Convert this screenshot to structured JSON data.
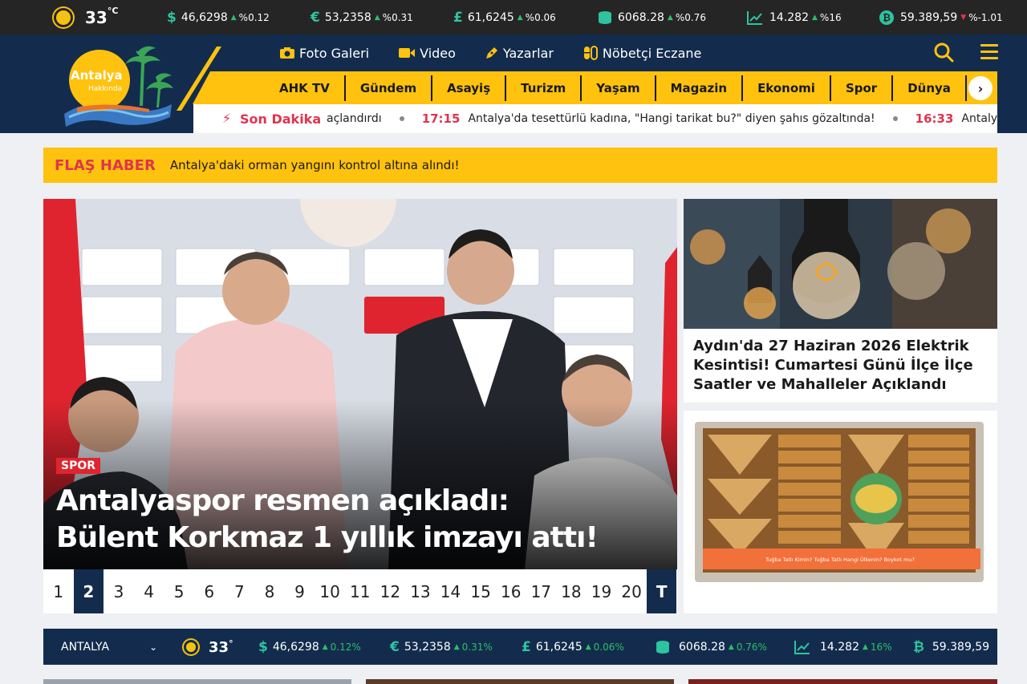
{
  "topbar": {
    "temperature": "33",
    "temperature_unit": "°C",
    "tickers": [
      {
        "icon": "dollar-icon",
        "symbol": "$",
        "value": "46,6298",
        "change": "%0.12",
        "direction": "up"
      },
      {
        "icon": "euro-icon",
        "symbol": "€",
        "value": "53,2358",
        "change": "%0.31",
        "direction": "up"
      },
      {
        "icon": "pound-icon",
        "symbol": "£",
        "value": "61,6245",
        "change": "%0.06",
        "direction": "up"
      },
      {
        "icon": "gold-coins-icon",
        "symbol": "",
        "value": "6068.28",
        "change": "%0.76",
        "direction": "up"
      },
      {
        "icon": "chart-line-icon",
        "symbol": "",
        "value": "14.282",
        "change": "%16",
        "direction": "up"
      },
      {
        "icon": "bitcoin-icon",
        "symbol": "₿",
        "value": "59.389,59",
        "change": "%-1.01",
        "direction": "down"
      }
    ]
  },
  "logo": {
    "line1": "Antalya",
    "line2": "Hakkında"
  },
  "nav": {
    "photo_gallery": "Foto Galeri",
    "video": "Video",
    "writers": "Yazarlar",
    "pharmacy": "Nöbetçi Eczane"
  },
  "categories": [
    "AHK TV",
    "Gündem",
    "Asayiş",
    "Turizm",
    "Yaşam",
    "Magazin",
    "Ekonomi",
    "Spor",
    "Dünya"
  ],
  "breaking": {
    "label": "Son Dakika",
    "items": [
      {
        "time": "",
        "text": "açlandırdı"
      },
      {
        "time": "17:15",
        "text": "Antalya'da tesettürlü kadına, \"Hangi tarikat bu?\" diyen şahıs gözaltında!"
      },
      {
        "time": "16:33",
        "text": "Antalya'd"
      }
    ]
  },
  "flash": {
    "label": "FLAŞ HABER",
    "text": "Antalya'daki orman yangını kontrol altına alındı!"
  },
  "hero": {
    "tag": "SPOR",
    "title": "Antalyaspor resmen açıkladı: Bülent Korkmaz 1 yıllık imzayı attı!",
    "pages": [
      "1",
      "2",
      "3",
      "4",
      "5",
      "6",
      "7",
      "8",
      "9",
      "10",
      "11",
      "12",
      "13",
      "14",
      "15",
      "16",
      "17",
      "18",
      "19",
      "20",
      "T"
    ],
    "active_page": "2"
  },
  "side": {
    "card1_title": "Aydın'da 27 Haziran 2026 Elektrik Kesintisi! Cumartesi Günü İlçe İlçe Saatler ve Mahalleler Açıklandı",
    "card2_caption": "Tuğba Tatlı Kimin? Tuğba Tatlı Hangi Ülkenin? Boykot mu?"
  },
  "bottombar": {
    "city": "ANTALYA",
    "temperature": "33",
    "temperature_unit": "°",
    "tickers": [
      {
        "symbol": "$",
        "value": "46,6298",
        "change": "0.12%"
      },
      {
        "symbol": "€",
        "value": "53,2358",
        "change": "0.31%"
      },
      {
        "symbol": "£",
        "value": "61,6245",
        "change": "0.06%"
      },
      {
        "symbol": "",
        "value": "6068.28",
        "change": "0.76%"
      },
      {
        "symbol": "",
        "value": "14.282",
        "change": "16%"
      },
      {
        "symbol": "₿",
        "value": "59.389,59",
        "change": ""
      }
    ]
  },
  "colors": {
    "navy": "#132c4d",
    "yellow": "#ffc20e",
    "red": "#e0344d",
    "green": "#2bbf6a",
    "dark": "#252525"
  }
}
